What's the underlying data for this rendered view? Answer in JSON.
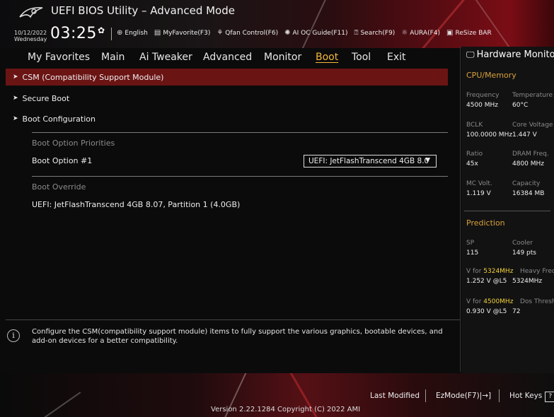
{
  "header": {
    "title": "UEFI BIOS Utility – Advanced Mode",
    "date": "10/12/2022",
    "day": "Wednesday",
    "time": "03:25",
    "toolbar": [
      {
        "icon": "globe-icon",
        "label": "English"
      },
      {
        "icon": "favorites-icon",
        "label": "MyFavorite(F3)"
      },
      {
        "icon": "fan-icon",
        "label": "Qfan Control(F6)"
      },
      {
        "icon": "ai-oc-icon",
        "label": "AI OC Guide(F11)"
      },
      {
        "icon": "search-icon",
        "label": "Search(F9)"
      },
      {
        "icon": "aura-icon",
        "label": "AURA(F4)"
      },
      {
        "icon": "resize-bar-icon",
        "label": "ReSize BAR"
      }
    ]
  },
  "menu": {
    "items": [
      "My Favorites",
      "Main",
      "Ai Tweaker",
      "Advanced",
      "Monitor",
      "Boot",
      "Tool",
      "Exit"
    ],
    "active": "Boot"
  },
  "main": {
    "submenus": [
      "CSM (Compatibility Support Module)",
      "Secure Boot",
      "Boot Configuration"
    ],
    "boot_priorities_label": "Boot Option Priorities",
    "boot_option1_label": "Boot Option #1",
    "boot_option1_value": "UEFI: JetFlashTranscend 4GB 8.0",
    "boot_override_label": "Boot Override",
    "boot_override_item": "UEFI: JetFlashTranscend 4GB 8.07, Partition 1 (4.0GB)"
  },
  "help": {
    "text": "Configure the CSM(compatibility support module) items to fully support the various graphics, bootable devices, and add-on devices for a better compatibility."
  },
  "hardware_monitor": {
    "title": "Hardware Monitor",
    "cpu_memory_heading": "CPU/Memory",
    "frequency_label": "Frequency",
    "frequency_value": "4500 MHz",
    "temperature_label": "Temperature",
    "temperature_value": "60°C",
    "bclk_label": "BCLK",
    "bclk_value": "100.0000 MHz",
    "core_voltage_label": "Core Voltage",
    "core_voltage_value": "1.447 V",
    "ratio_label": "Ratio",
    "ratio_value": "45x",
    "dram_freq_label": "DRAM Freq.",
    "dram_freq_value": "4800 MHz",
    "mc_volt_label": "MC Volt.",
    "mc_volt_value": "1.119 V",
    "capacity_label": "Capacity",
    "capacity_value": "16384 MB",
    "prediction_heading": "Prediction",
    "sp_label": "SP",
    "sp_value": "115",
    "cooler_label": "Cooler",
    "cooler_value": "149 pts",
    "v_for_prefix": "V for ",
    "v_for1_freq": "5324MHz",
    "v_for1_right_label": "Heavy Freq",
    "v_for1_value": "1.252 V @L5",
    "v_for1_right_value": "5324MHz",
    "v_for2_freq": "4500MHz",
    "v_for2_right_label": "Dos Thresh",
    "v_for2_value": "0.930 V @L5",
    "v_for2_right_value": "72"
  },
  "footer": {
    "version": "Version 2.22.1284 Copyright (C) 2022 AMI",
    "last_modified": "Last Modified",
    "ezmode": "EzMode(F7)|→]",
    "hotkeys": "Hot Keys"
  },
  "colors": {
    "accent": "#f5b73b",
    "selected_row": "#6b1414",
    "hw_heading": "#d9a13a",
    "highlight_yellow": "#f2d23a"
  }
}
